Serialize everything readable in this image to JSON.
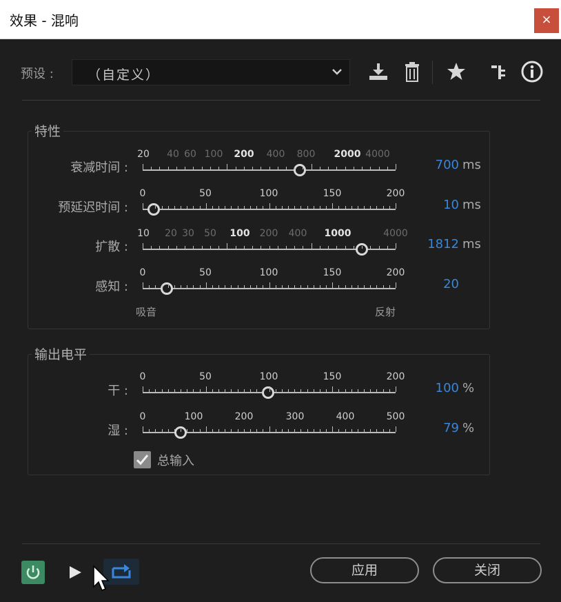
{
  "window": {
    "title": "效果 - 混响",
    "close_label": "×"
  },
  "preset": {
    "label": "预设 :",
    "value": "（自定义）"
  },
  "toolbar": {
    "icons": [
      "save-preset-icon",
      "delete-icon",
      "favorite-star-icon",
      "routing-icon",
      "info-icon"
    ]
  },
  "characteristics": {
    "title": "特性",
    "decay": {
      "label": "衰减时间 :",
      "ticks": [
        "20",
        "40",
        "60",
        "100",
        "200",
        "400",
        "800",
        "2000",
        "4000"
      ],
      "value": "700",
      "unit": "ms"
    },
    "predelay": {
      "label": "预延迟时间 :",
      "ticks": [
        "0",
        "50",
        "100",
        "150",
        "200"
      ],
      "value": "10",
      "unit": "ms"
    },
    "diffusion": {
      "label": "扩散 :",
      "ticks": [
        "10",
        "20",
        "30",
        "50",
        "100",
        "200",
        "400",
        "1000",
        "4000"
      ],
      "value": "1812",
      "unit": "ms"
    },
    "perception": {
      "label": "感知 :",
      "ticks": [
        "0",
        "50",
        "100",
        "150",
        "200"
      ],
      "value": "20",
      "left_hint": "吸音",
      "right_hint": "反射"
    }
  },
  "output_levels": {
    "title": "输出电平",
    "dry": {
      "label": "干 :",
      "ticks": [
        "0",
        "50",
        "100",
        "150",
        "200"
      ],
      "value": "100",
      "unit": "%"
    },
    "wet": {
      "label": "湿 :",
      "ticks": [
        "0",
        "100",
        "200",
        "300",
        "400",
        "500"
      ],
      "value": "79",
      "unit": "%"
    },
    "master_input": {
      "label": "总输入",
      "checked": true
    }
  },
  "footer": {
    "apply_label": "应用",
    "close_label": "关闭"
  },
  "colors": {
    "accent_value": "#3a86d8",
    "power": "#3c8a62",
    "close_button": "#c94f3d"
  }
}
